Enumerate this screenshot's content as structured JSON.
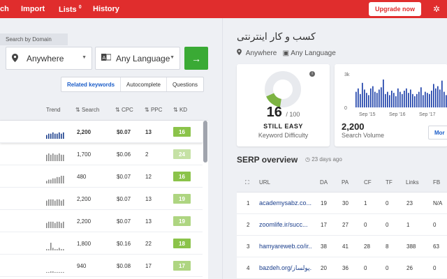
{
  "nav": {
    "search": "ch",
    "import": "Import",
    "lists": "Lists",
    "lists_count": "0",
    "history": "History",
    "upgrade": "Upgrade now",
    "gear_icon": "gear-icon"
  },
  "search": {
    "domain_label": "Search by Domain",
    "location": "Anywhere",
    "language": "Any Language",
    "go_icon": "arrow-right-icon"
  },
  "tabs": [
    "Related keywords",
    "Autocomplete",
    "Questions"
  ],
  "kw_table": {
    "headers": [
      "Trend",
      "Search",
      "CPC",
      "PPC",
      "KD"
    ],
    "rows": [
      {
        "search": "2,200",
        "cpc": "$0.07",
        "ppc": "13",
        "kd": "16",
        "kd_color": "#8bc34a",
        "trend": [
          3,
          4,
          4,
          5,
          4,
          4,
          5,
          4,
          5
        ]
      },
      {
        "search": "1,700",
        "cpc": "$0.06",
        "ppc": "2",
        "kd": "24",
        "kd_color": "#c5e1a5",
        "trend": [
          5,
          6,
          5,
          6,
          5,
          5,
          6,
          5,
          5
        ]
      },
      {
        "search": "480",
        "cpc": "$0.07",
        "ppc": "12",
        "kd": "16",
        "kd_color": "#8bc34a",
        "trend": [
          2,
          3,
          3,
          4,
          4,
          5,
          5,
          6,
          6
        ]
      },
      {
        "search": "2,200",
        "cpc": "$0.07",
        "ppc": "13",
        "kd": "19",
        "kd_color": "#aed581",
        "trend": [
          4,
          5,
          5,
          5,
          4,
          5,
          5,
          4,
          5
        ]
      },
      {
        "search": "2,200",
        "cpc": "$0.07",
        "ppc": "13",
        "kd": "19",
        "kd_color": "#aed581",
        "trend": [
          4,
          5,
          5,
          5,
          4,
          5,
          5,
          4,
          5
        ]
      },
      {
        "search": "1,800",
        "cpc": "$0.16",
        "ppc": "22",
        "kd": "18",
        "kd_color": "#8bc34a",
        "trend": [
          1,
          1,
          6,
          2,
          1,
          1,
          2,
          1,
          1
        ]
      },
      {
        "search": "940",
        "cpc": "$0.08",
        "ppc": "17",
        "kd": "17",
        "kd_color": "#aed581",
        "trend": [
          0,
          0,
          1,
          1,
          0,
          0,
          0,
          0,
          0
        ]
      }
    ]
  },
  "keyword": {
    "title": "کسب و کار اینترنتی",
    "location": "Anywhere",
    "language": "Any Language"
  },
  "kd_card": {
    "score": "16",
    "of": "/ 100",
    "label": "STILL EASY",
    "sub": "Keyword Difficulty",
    "percent": 16
  },
  "sv_card": {
    "volume": "2,200",
    "sub": "Search Volume",
    "more": "Mor",
    "chart_data": {
      "type": "bar",
      "yticks": [
        "3k",
        "0"
      ],
      "ylim": [
        0,
        3000
      ],
      "xticks": [
        "Sep '15",
        "Sep '16",
        "Sep '17"
      ],
      "values": [
        1400,
        1700,
        1200,
        2200,
        1600,
        1300,
        1100,
        1700,
        1900,
        1400,
        1300,
        1600,
        1800,
        2500,
        1200,
        1400,
        1100,
        1500,
        1300,
        1000,
        1700,
        1400,
        1200,
        1500,
        1700,
        1300,
        1600,
        1200,
        1000,
        1200,
        1400,
        1800,
        1100,
        1400,
        1300,
        1200,
        1500,
        2100,
        1700,
        1900,
        1600,
        2400,
        1400,
        1100
      ]
    }
  },
  "serp": {
    "title": "SERP overview",
    "age": "23 days ago",
    "headers": [
      "URL",
      "DA",
      "PA",
      "CF",
      "TF",
      "Links",
      "FB"
    ],
    "rows": [
      {
        "rank": "1",
        "url": "academysabz.co...",
        "da": "19",
        "pa": "30",
        "cf": "1",
        "tf": "0",
        "links": "23",
        "fb": "N/A"
      },
      {
        "rank": "2",
        "url": "zoomlife.ir/succ...",
        "da": "17",
        "pa": "27",
        "cf": "0",
        "tf": "0",
        "links": "1",
        "fb": "0"
      },
      {
        "rank": "3",
        "url": "hamyareweb.co/ir...",
        "da": "38",
        "pa": "41",
        "cf": "28",
        "tf": "8",
        "links": "388",
        "fb": "63"
      },
      {
        "rank": "4",
        "url": "bazdeh.org/پولساز...",
        "da": "20",
        "pa": "36",
        "cf": "0",
        "tf": "0",
        "links": "26",
        "fb": "0"
      }
    ]
  }
}
